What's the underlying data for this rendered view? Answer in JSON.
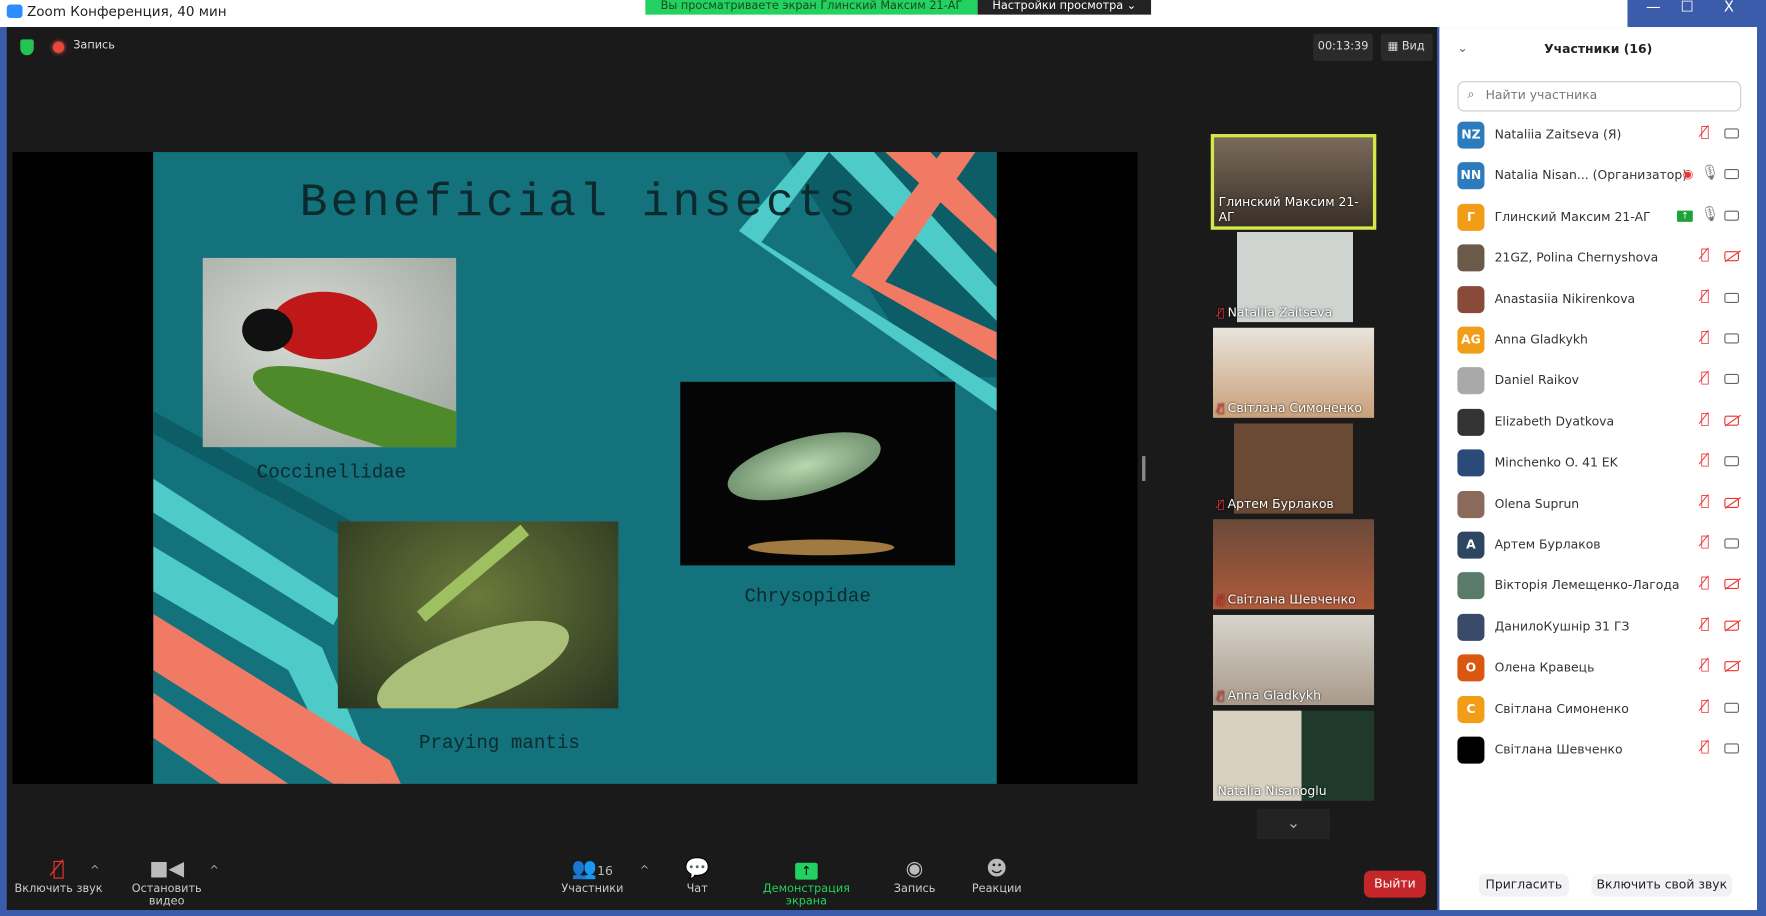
{
  "window": {
    "title": "Zoom Конференция, 40 мин",
    "banner": "Вы просматриваете экран Глинский Максим 21-АГ",
    "view_settings": "Настройки просмотра ⌄",
    "minimize": "—",
    "maximize": "☐",
    "close": "X"
  },
  "topbar": {
    "record_label": "Запись",
    "timer": "00:13:39",
    "view_label": "Вид"
  },
  "slide": {
    "title": "Beneficial insects",
    "labels": [
      "Coccinellidae",
      "Chrysopidae",
      "Praying mantis"
    ]
  },
  "thumbnails": [
    {
      "name": "Глинский Максим 21-АГ",
      "muted": false,
      "active": true
    },
    {
      "name": "Nataliia Zaitseva",
      "muted": true
    },
    {
      "name": "Світлана Симоненко",
      "muted": true
    },
    {
      "name": "Артем Бурлаков",
      "muted": true
    },
    {
      "name": "Світлана Шевченко",
      "muted": true
    },
    {
      "name": "Anna Gladkykh",
      "muted": true
    },
    {
      "name": "Natalia Nisanoglu",
      "muted": false
    }
  ],
  "toolbar": {
    "unmute": "Включить звук",
    "stop_video": "Остановить видео",
    "participants": "Участники",
    "participants_count": "16",
    "chat": "Чат",
    "share": "Демонстрация экрана",
    "record": "Запись",
    "reactions": "Реакции",
    "leave": "Выйти"
  },
  "panel": {
    "title": "Участники (16)",
    "search_placeholder": "Найти участника",
    "invite": "Пригласить",
    "unmute_self": "Включить свой звук",
    "participants": [
      {
        "initials": "NZ",
        "name": "Nataliia Zaitseva (Я)",
        "color": "#2b7bbd",
        "mic": "muted",
        "cam": "on"
      },
      {
        "initials": "NN",
        "name": "Natalia Nisan...  (Организатор)",
        "color": "#2b7bbd",
        "mic": "on",
        "cam": "on",
        "recording": true
      },
      {
        "initials": "Г",
        "name": "Глинский Максим 21-АГ",
        "color": "#f29d18",
        "mic": "on",
        "cam": "on",
        "sharing": true
      },
      {
        "initials": "",
        "name": "21GZ, Polina Chernyshova",
        "color": "#6b5a4a",
        "mic": "muted",
        "cam": "off"
      },
      {
        "initials": "",
        "name": "Anastasiia Nikirenkova",
        "color": "#8a4a3a",
        "mic": "muted",
        "cam": "on"
      },
      {
        "initials": "AG",
        "name": "Anna Gladkykh",
        "color": "#f29d18",
        "mic": "muted",
        "cam": "on"
      },
      {
        "initials": "",
        "name": "Daniel Raikov",
        "color": "#a9a9a9",
        "mic": "muted",
        "cam": "on"
      },
      {
        "initials": "",
        "name": "Elizabeth Dyatkova",
        "color": "#333333",
        "mic": "muted",
        "cam": "off"
      },
      {
        "initials": "",
        "name": "Minchenko O. 41 EK",
        "color": "#2a4a7a",
        "mic": "muted",
        "cam": "on"
      },
      {
        "initials": "",
        "name": "Olena Suprun",
        "color": "#8a6a5a",
        "mic": "muted",
        "cam": "off"
      },
      {
        "initials": "A",
        "name": "Артем Бурлаков",
        "color": "#2e4660",
        "mic": "muted",
        "cam": "on"
      },
      {
        "initials": "",
        "name": "Вікторія Лемещенко-Лагода",
        "color": "#5a7a6a",
        "mic": "muted",
        "cam": "off"
      },
      {
        "initials": "",
        "name": "ДанилоКушнір 31 ГЗ",
        "color": "#3a4a6a",
        "mic": "muted",
        "cam": "off"
      },
      {
        "initials": "О",
        "name": "Олена Кравець",
        "color": "#d9570f",
        "mic": "muted",
        "cam": "off"
      },
      {
        "initials": "С",
        "name": "Світлана Симоненко",
        "color": "#f29d18",
        "mic": "muted",
        "cam": "on"
      },
      {
        "initials": "",
        "name": "Світлана Шевченко",
        "color": "#000000",
        "mic": "muted",
        "cam": "on"
      }
    ]
  }
}
